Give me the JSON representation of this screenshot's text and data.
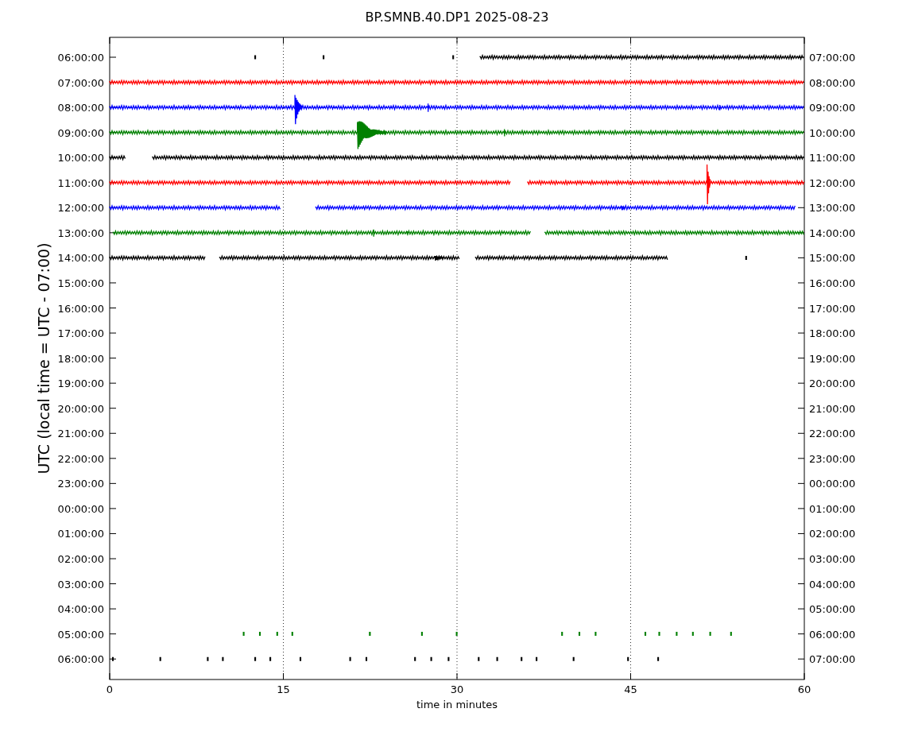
{
  "title": "BP.SMNB.40.DP1 2025-08-23",
  "ylabel": "UTC (local time = UTC - 07:00)",
  "xlabel": "time in minutes",
  "xticks": [
    "0",
    "15",
    "30",
    "45",
    "60"
  ],
  "rows": [
    {
      "utc": "06:00:00",
      "local": "07:00:00",
      "color": "#000000"
    },
    {
      "utc": "07:00:00",
      "local": "08:00:00",
      "color": "#ff0000"
    },
    {
      "utc": "08:00:00",
      "local": "09:00:00",
      "color": "#0000ff"
    },
    {
      "utc": "09:00:00",
      "local": "10:00:00",
      "color": "#008000"
    },
    {
      "utc": "10:00:00",
      "local": "11:00:00",
      "color": "#000000"
    },
    {
      "utc": "11:00:00",
      "local": "12:00:00",
      "color": "#ff0000"
    },
    {
      "utc": "12:00:00",
      "local": "13:00:00",
      "color": "#0000ff"
    },
    {
      "utc": "13:00:00",
      "local": "14:00:00",
      "color": "#008000"
    },
    {
      "utc": "14:00:00",
      "local": "15:00:00",
      "color": "#000000"
    },
    {
      "utc": "15:00:00",
      "local": "16:00:00"
    },
    {
      "utc": "16:00:00",
      "local": "17:00:00"
    },
    {
      "utc": "17:00:00",
      "local": "18:00:00"
    },
    {
      "utc": "18:00:00",
      "local": "19:00:00"
    },
    {
      "utc": "19:00:00",
      "local": "20:00:00"
    },
    {
      "utc": "20:00:00",
      "local": "21:00:00"
    },
    {
      "utc": "21:00:00",
      "local": "22:00:00"
    },
    {
      "utc": "22:00:00",
      "local": "23:00:00"
    },
    {
      "utc": "23:00:00",
      "local": "00:00:00"
    },
    {
      "utc": "00:00:00",
      "local": "01:00:00"
    },
    {
      "utc": "01:00:00",
      "local": "02:00:00"
    },
    {
      "utc": "02:00:00",
      "local": "03:00:00"
    },
    {
      "utc": "03:00:00",
      "local": "04:00:00"
    },
    {
      "utc": "04:00:00",
      "local": "05:00:00"
    },
    {
      "utc": "05:00:00",
      "local": "06:00:00",
      "color": "#008000"
    },
    {
      "utc": "06:00:00",
      "local": "07:00:00",
      "color": "#000000"
    }
  ]
}
